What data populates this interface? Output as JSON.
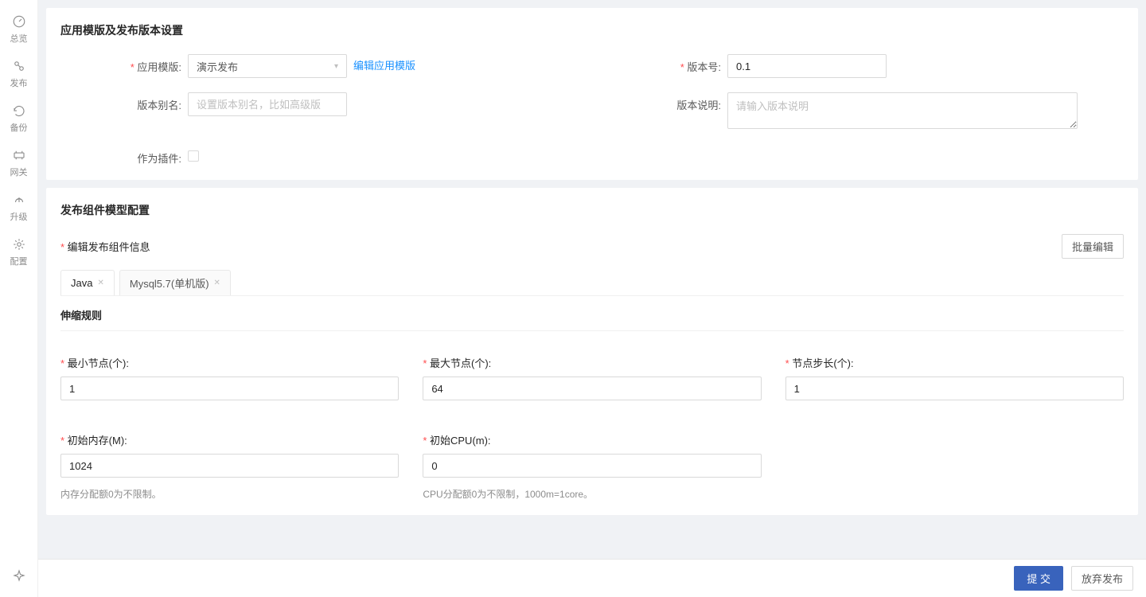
{
  "sidebar": {
    "items": [
      {
        "label": "总览"
      },
      {
        "label": "发布"
      },
      {
        "label": "备份"
      },
      {
        "label": "网关"
      },
      {
        "label": "升级"
      },
      {
        "label": "配置"
      }
    ]
  },
  "panel1": {
    "title": "应用模版及发布版本设置",
    "template_label": "应用模版:",
    "template_value": "演示发布",
    "edit_template": "编辑应用模版",
    "version_label": "版本号:",
    "version_value": "0.1",
    "alias_label": "版本别名:",
    "alias_placeholder": "设置版本别名，比如高级版",
    "desc_label": "版本说明:",
    "desc_placeholder": "请输入版本说明",
    "plugin_label": "作为插件:"
  },
  "panel2": {
    "title": "发布组件模型配置",
    "sub_title": "编辑发布组件信息",
    "batch_edit": "批量编辑",
    "tabs": [
      {
        "label": "Java"
      },
      {
        "label": "Mysql5.7(单机版)"
      }
    ],
    "scaling_title": "伸缩规则",
    "min_node_label": "最小节点(个):",
    "min_node_value": "1",
    "max_node_label": "最大节点(个):",
    "max_node_value": "64",
    "step_label": "节点步长(个):",
    "step_value": "1",
    "mem_label": "初始内存(M):",
    "mem_value": "1024",
    "mem_hint": "内存分配额0为不限制。",
    "cpu_label": "初始CPU(m):",
    "cpu_value": "0",
    "cpu_hint": "CPU分配额0为不限制，1000m=1core。"
  },
  "footer": {
    "submit": "提 交",
    "abandon": "放弃发布"
  }
}
